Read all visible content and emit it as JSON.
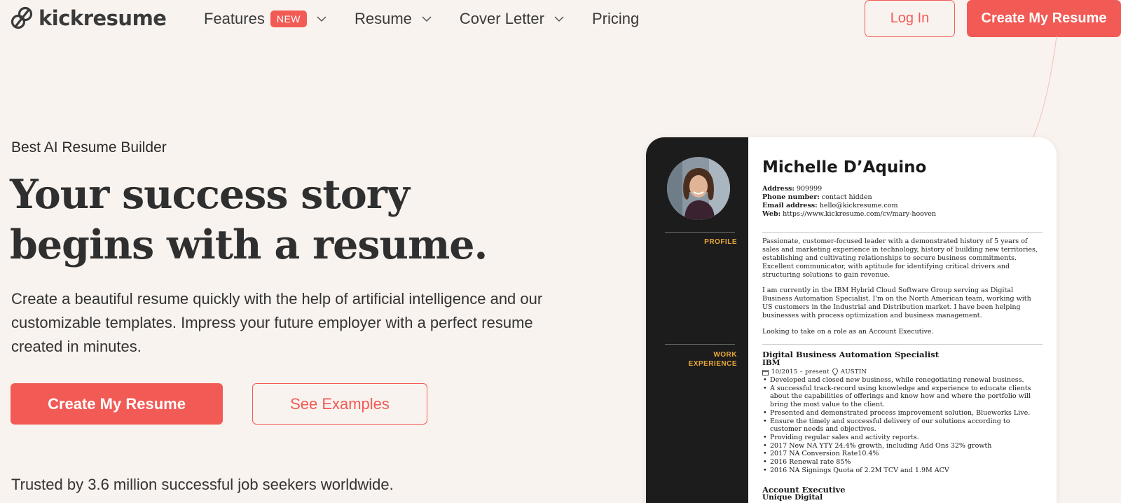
{
  "header": {
    "logo_text": "kickresume",
    "nav": [
      {
        "label": "Features",
        "badge": "NEW"
      },
      {
        "label": "Resume"
      },
      {
        "label": "Cover Letter"
      },
      {
        "label": "Pricing"
      }
    ],
    "login_label": "Log In",
    "create_label": "Create My Resume"
  },
  "hero": {
    "eyebrow": "Best AI Resume Builder",
    "headline_line1": "Your success story",
    "headline_line2": "begins with a resume.",
    "subtext": "Create a beautiful resume quickly with the help of artificial intelligence and our customizable templates. Impress your future employer with a perfect resume created in minutes.",
    "cta_primary": "Create My Resume",
    "cta_secondary": "See Examples",
    "trusted": "Trusted by 3.6 million successful job seekers worldwide."
  },
  "resume": {
    "name": "Michelle D’Aquino",
    "contact": [
      {
        "label": "Address:",
        "value": "909999"
      },
      {
        "label": "Phone number:",
        "value": "contact hidden"
      },
      {
        "label": "Email address:",
        "value": "hello@kickresume.com"
      },
      {
        "label": "Web:",
        "value": "https://www.kickresume.com/cv/mary-hooven"
      }
    ],
    "side_profile": "PROFILE",
    "side_work_1": "WORK",
    "side_work_2": "EXPERIENCE",
    "profile_p1": "Passionate, customer-focused leader with a demonstrated history of 5 years of sales and marketing experience in technology, history of building new territories, establishing and cultivating relationships to secure business commitments. Excellent communicator, with aptitude for identifying critical drivers and structuring solutions to gain revenue.",
    "profile_p2": "I am currently in the IBM Hybrid Cloud Software Group serving as Digital Business Automation Specialist. I'm on the North American team, working with US customers in the Industrial and Distribution market. I have been helping businesses with process optimization and business management.",
    "profile_p3": "Looking to take on a role as an Account Executive.",
    "job1": {
      "title": "Digital Business Automation Specialist",
      "company": "IBM",
      "dates": "10/2015 – present",
      "location": "AUSTIN",
      "bullets": [
        "Developed and closed new business, while renegotiating renewal business.",
        "A successful track-record using knowledge and experience to educate clients about the capabilities of offerings and know how and where the portfolio will bring the most value to the client.",
        "Presented and demonstrated process improvement solution, Blueworks Live.",
        "Ensure the timely and successful delivery of our solutions according to customer needs and objectives.",
        "Providing regular sales and activity reports.",
        "2017 New NA YTY 24.4% growth, including Add Ons 32% growth",
        "2017 NA Conversion Rate10.4%",
        "2016 Renewal rate 85%",
        "2016 NA Signings Quota of 2.2M TCV and 1.9M ACV"
      ]
    },
    "job2": {
      "title": "Account Executive",
      "company": "Unique Digital"
    }
  }
}
